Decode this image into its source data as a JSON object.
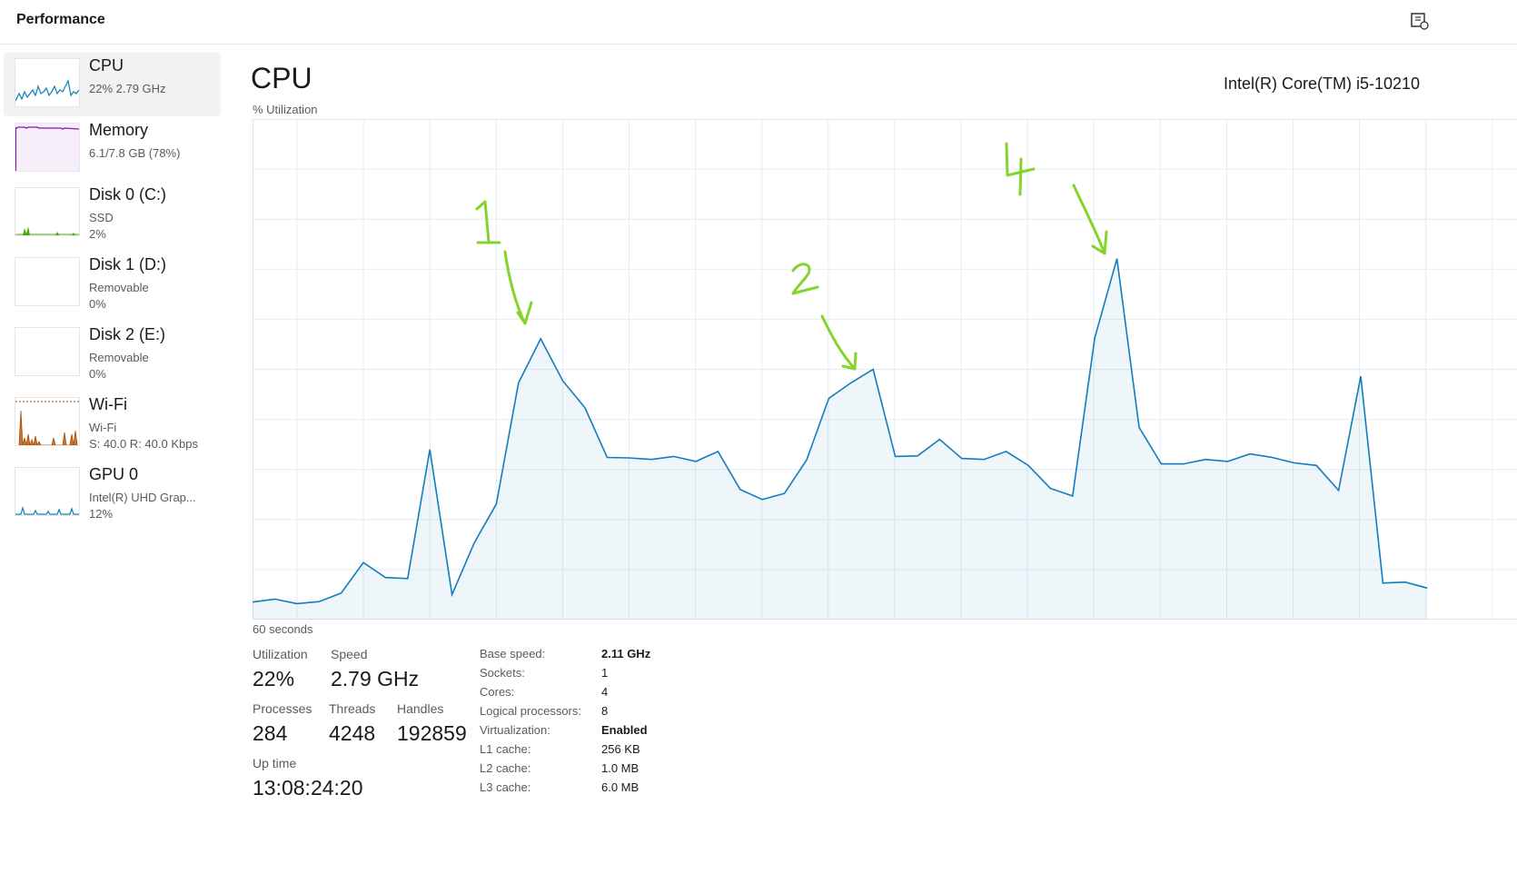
{
  "window": {
    "title": "Performance"
  },
  "sidebar": {
    "items": [
      {
        "name": "CPU",
        "lines": [
          "22%  2.79 GHz"
        ],
        "color": "#117dbb",
        "values": [
          10,
          12,
          18,
          14,
          30,
          22,
          46,
          28,
          20,
          60,
          34,
          28,
          52,
          40,
          26,
          72,
          38,
          22,
          30,
          18
        ],
        "selected": true
      },
      {
        "name": "Memory",
        "lines": [
          "6.1/7.8 GB (78%)"
        ],
        "color": "#8b12ae",
        "values": [
          78,
          78,
          79,
          78,
          78,
          78,
          78,
          78,
          78,
          78,
          78,
          78,
          78,
          77,
          78,
          78,
          78,
          78,
          78,
          78
        ],
        "selected": false
      },
      {
        "name": "Disk 0 (C:)",
        "lines": [
          "SSD",
          "2%"
        ],
        "color": "#4da60c",
        "values": [
          0,
          0,
          0,
          0,
          0,
          0,
          0,
          0,
          0,
          0,
          0,
          0,
          0,
          0,
          0,
          0,
          0,
          0,
          0,
          0
        ],
        "selected": false
      },
      {
        "name": "Disk 1 (D:)",
        "lines": [
          "Removable",
          "0%"
        ],
        "color": "#4da60c",
        "values": [],
        "selected": false
      },
      {
        "name": "Disk 2 (E:)",
        "lines": [
          "Removable",
          "0%"
        ],
        "color": "#4da60c",
        "values": [],
        "selected": false
      },
      {
        "name": "Wi-Fi",
        "lines": [
          "Wi-Fi",
          "S: 40.0  R: 40.0 Kbps"
        ],
        "color": "#a74f01",
        "values": [],
        "selected": false
      },
      {
        "name": "GPU 0",
        "lines": [
          "Intel(R) UHD Grap...",
          "12%"
        ],
        "color": "#117dbb",
        "values": [],
        "selected": false
      }
    ]
  },
  "main": {
    "title": "CPU",
    "cpu_model": "Intel(R) Core(TM) i5-10210",
    "util_label": "% Utilization",
    "x_axis_label": "60 seconds",
    "stats": {
      "utilization_label": "Utilization",
      "utilization_value": "22%",
      "speed_label": "Speed",
      "speed_value": "2.79 GHz",
      "processes_label": "Processes",
      "processes_value": "284",
      "threads_label": "Threads",
      "threads_value": "4248",
      "handles_label": "Handles",
      "handles_value": "192859",
      "uptime_label": "Up time",
      "uptime_value": "13:08:24:20"
    },
    "specs": [
      {
        "key": "Base speed:",
        "value": "2.11 GHz",
        "bold": true
      },
      {
        "key": "Sockets:",
        "value": "1",
        "bold": false
      },
      {
        "key": "Cores:",
        "value": "4",
        "bold": false
      },
      {
        "key": "Logical processors:",
        "value": "8",
        "bold": false
      },
      {
        "key": "Virtualization:",
        "value": "Enabled",
        "bold": true
      },
      {
        "key": "L1 cache:",
        "value": "256 KB",
        "bold": false
      },
      {
        "key": "L2 cache:",
        "value": "1.0 MB",
        "bold": false
      },
      {
        "key": "L3 cache:",
        "value": "6.0 MB",
        "bold": false
      }
    ]
  },
  "chart_data": {
    "type": "area",
    "ylim": [
      0,
      100
    ],
    "grid": true,
    "series": [
      {
        "color": "#117dbb",
        "values": [
          3.5,
          4.1,
          3.2,
          3.6,
          5.3,
          11.4,
          8.4,
          8.2,
          34,
          5,
          15.3,
          23.1,
          47.3,
          56.1,
          47.7,
          42.3,
          32.4,
          32.3,
          32,
          32.6,
          31.6,
          33.6,
          26,
          24,
          25.2,
          31.9,
          44.2,
          47.3,
          50,
          32.6,
          32.7,
          36,
          32.2,
          32,
          33.6,
          30.8,
          26.2,
          24.7,
          56.3,
          72.1,
          38.4,
          31.1,
          31.1,
          32,
          31.6,
          33.1,
          32.4,
          31.3,
          30.8,
          25.8,
          48.6,
          7.3,
          7.5,
          6.3
        ]
      }
    ],
    "annotations": [
      {
        "text": "1",
        "color": "#84d42c"
      },
      {
        "text": "2",
        "color": "#84d42c"
      },
      {
        "text": "4",
        "color": "#84d42c"
      }
    ]
  }
}
